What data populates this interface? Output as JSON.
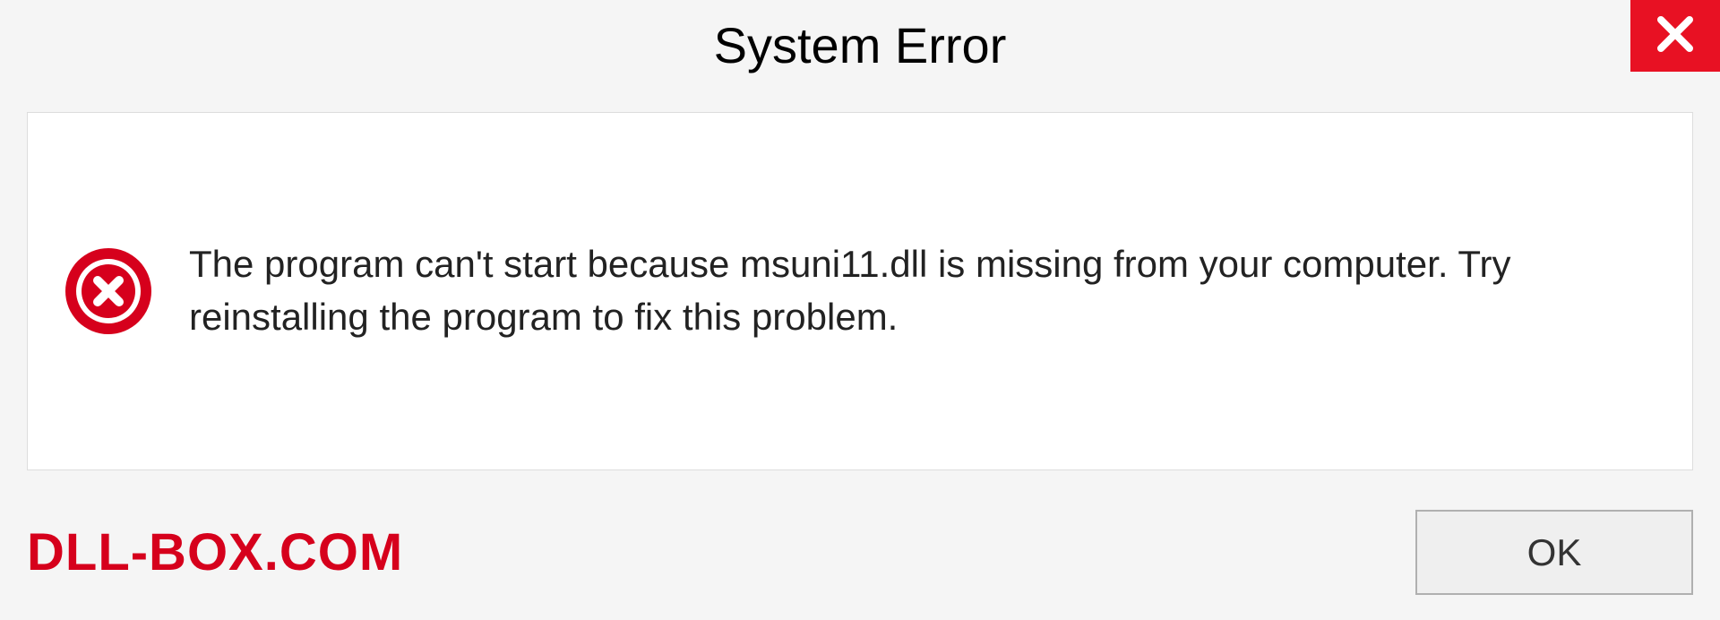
{
  "dialog": {
    "title": "System Error",
    "message": "The program can't start because msuni11.dll is missing from your computer. Try reinstalling the program to fix this problem.",
    "ok_label": "OK"
  },
  "watermark": "DLL-BOX.COM",
  "colors": {
    "close_bg": "#e81123",
    "watermark": "#d6001c"
  }
}
